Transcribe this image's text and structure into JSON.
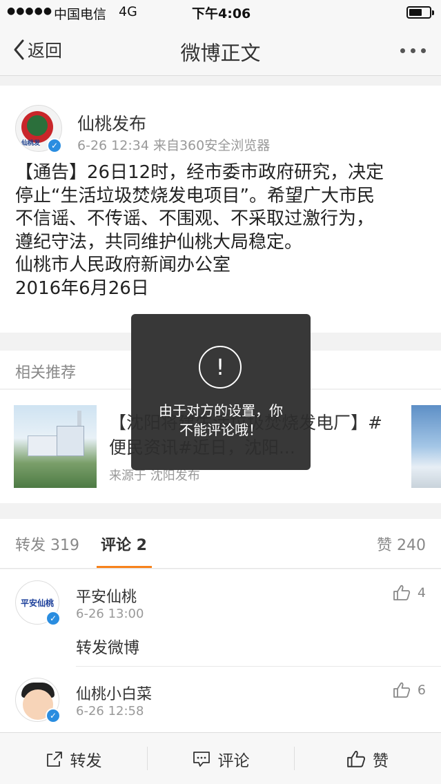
{
  "status_bar": {
    "signal": "●●●●●",
    "carrier": "中国电信",
    "network": "4G",
    "time": "下午4:06"
  },
  "nav": {
    "back_label": "返回",
    "title": "微博正文"
  },
  "post": {
    "author": "仙桃发布",
    "avatar_text": "仙桃发",
    "meta": "6-26 12:34  来自360安全浏览器",
    "body_lines": [
      "【通告】26日12时，经市委市政府研究，决定",
      "停止“生活垃圾焚烧发电项目”。希望广大市民",
      "不信谣、不传谣、不围观、不采取过激行为，",
      "遵纪守法，共同维护仙桃大局稳定。",
      "仙桃市人民政府新闻办公室",
      "2016年6月26日"
    ]
  },
  "related": {
    "heading": "相关推荐",
    "title": "【沈阳将建生活垃圾焚烧发电厂】#便民资讯#近日，沈阳...",
    "source": "来源于 沈阳发布"
  },
  "tabs": {
    "repost": "转发 319",
    "comments": "评论 2",
    "likes": "赞 240"
  },
  "comments": [
    {
      "name": "平安仙桃",
      "time": "6-26 13:00",
      "text": "转发微博",
      "likes": "4",
      "avatar_text": "平安仙桃"
    },
    {
      "name": "仙桃小白菜",
      "time": "6-26 12:58",
      "text": "",
      "likes": "6"
    }
  ],
  "bottom_bar": {
    "repost": "转发",
    "comment": "评论",
    "like": "赞"
  },
  "toast": {
    "icon": "!",
    "message_line1": "由于对方的设置，你",
    "message_line2": "不能评论哦！"
  },
  "colors": {
    "accent": "#f7821b",
    "verified": "#2a8de0"
  }
}
